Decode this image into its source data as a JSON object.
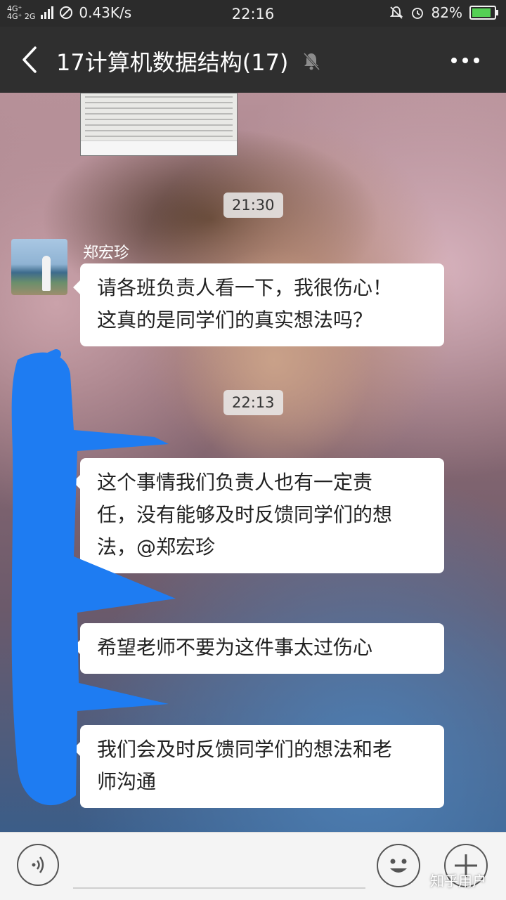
{
  "status_bar": {
    "network_top": "4G⁺",
    "network_bottom": "4G⁺ 2G",
    "speed": "0.43K/s",
    "time": "22:16",
    "battery": "82%",
    "battery_color": "#54d054"
  },
  "header": {
    "title": "17计算机数据结构(17)",
    "back_icon": "chevron-left-icon",
    "mute_icon": "bell-muted-icon",
    "more_icon": "more-horizontal-icon"
  },
  "chat": {
    "timestamps": [
      "21:30",
      "22:13"
    ],
    "sender_name": "郑宏珍",
    "messages": [
      {
        "lines": [
          "请各班负责人看一下，我很伤心！",
          "这真的是同学们的真实想法吗？"
        ]
      },
      {
        "lines": [
          "这个事情我们负责人也有一定责",
          "任，没有能够及时反馈同学们的想",
          "法，@郑宏珍"
        ]
      },
      {
        "lines": [
          "希望老师不要为这件事太过伤心"
        ]
      },
      {
        "lines": [
          "我们会及时反馈同学们的想法和老",
          "师沟通"
        ]
      }
    ],
    "redaction_color": "#1e7cf2"
  },
  "input_bar": {
    "voice_icon": "voice-icon",
    "emoji_icon": "emoji-icon",
    "plus_icon": "plus-icon"
  },
  "watermark": "知乎用户"
}
